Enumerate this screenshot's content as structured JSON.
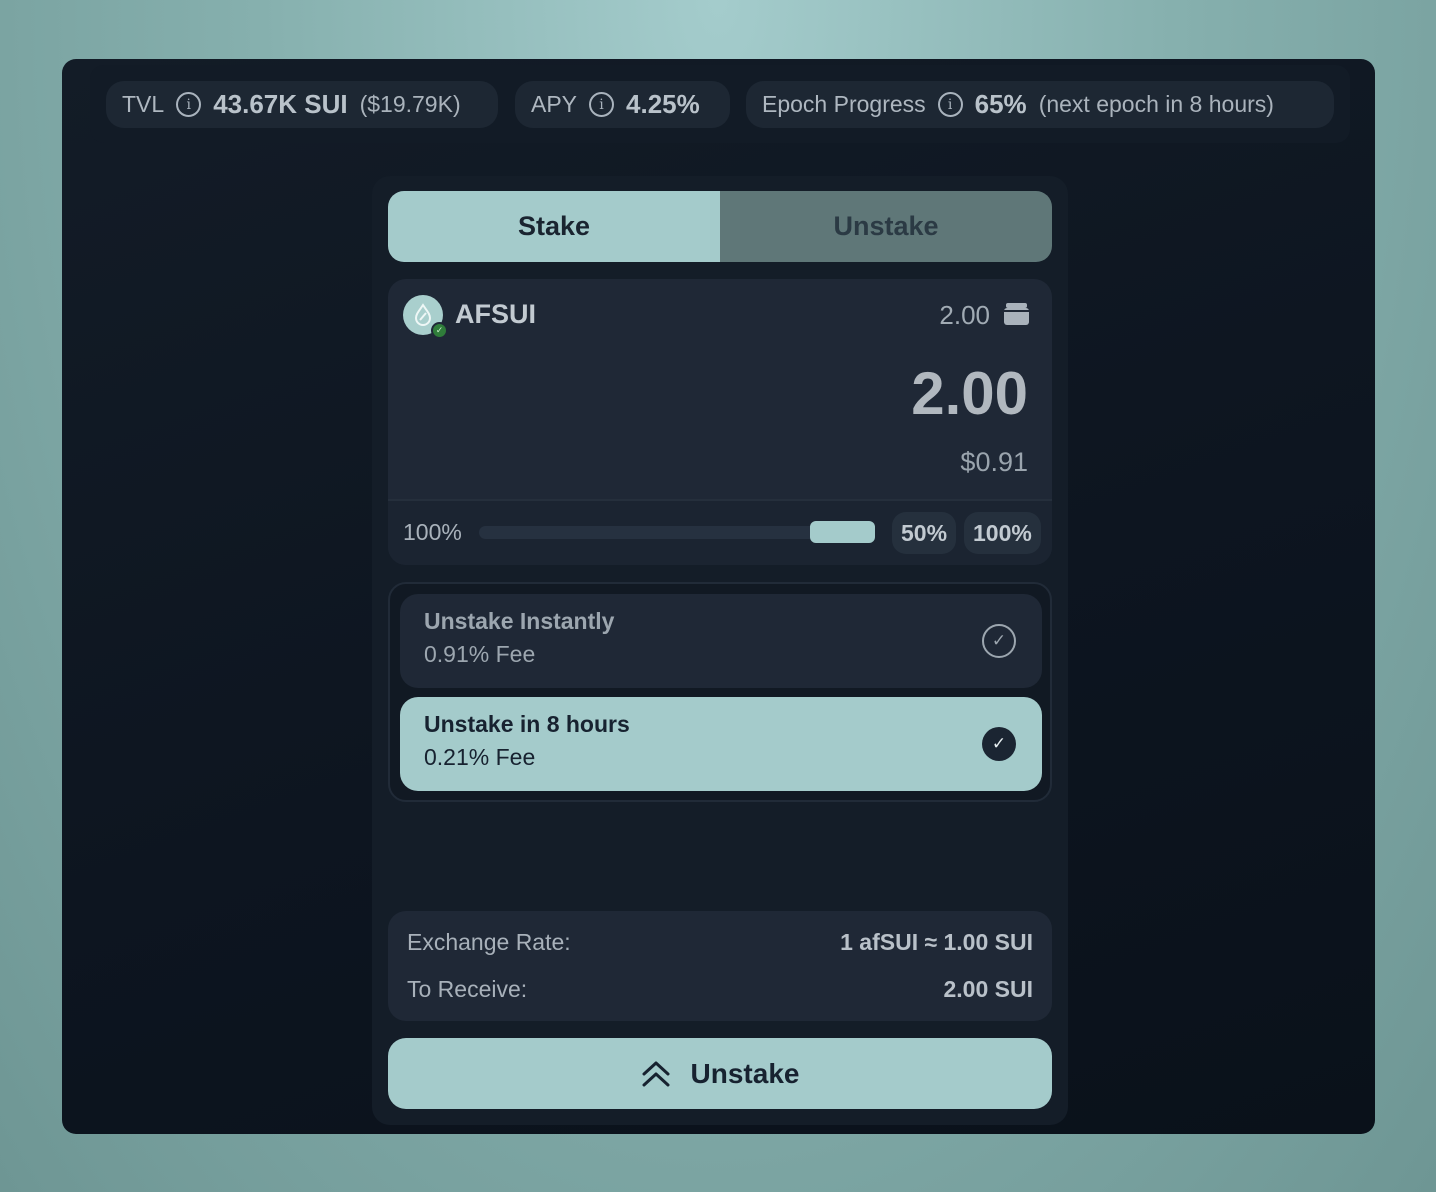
{
  "stats": {
    "tvl": {
      "label": "TVL",
      "value": "43.67K SUI",
      "sub": "($19.79K)"
    },
    "apy": {
      "label": "APY",
      "value": "4.25%"
    },
    "epoch": {
      "label": "Epoch Progress",
      "value": "65%",
      "progress_fraction": 0.65,
      "sub": "(next epoch in 8 hours)"
    }
  },
  "tabs": [
    {
      "label": "Stake",
      "active": true
    },
    {
      "label": "Unstake",
      "active": false
    }
  ],
  "input": {
    "token": "AFSUI",
    "token_icon": "droplet-icon",
    "balance": "2.00",
    "wallet_icon": "wallet-icon",
    "amount": "2.00",
    "usd": "$0.91",
    "slider_label": "100%",
    "slider_fraction": 1.0,
    "pct_buttons": [
      "50%",
      "100%"
    ]
  },
  "options": [
    {
      "title": "Unstake Instantly",
      "fee": "0.91% Fee",
      "selected": false
    },
    {
      "title": "Unstake in 8 hours",
      "fee": "0.21% Fee",
      "selected": true
    }
  ],
  "summary": {
    "exchange_label": "Exchange Rate:",
    "exchange_value": "1 afSUI ≈ 1.00 SUI",
    "receive_label": "To Receive:",
    "receive_value": "2.00 SUI"
  },
  "submit": {
    "label": "Unstake",
    "icon": "double-chevron-up-icon"
  },
  "colors": {
    "accent": "#a4cbcb",
    "panel": "#1f2836",
    "background": "#0d1520"
  }
}
